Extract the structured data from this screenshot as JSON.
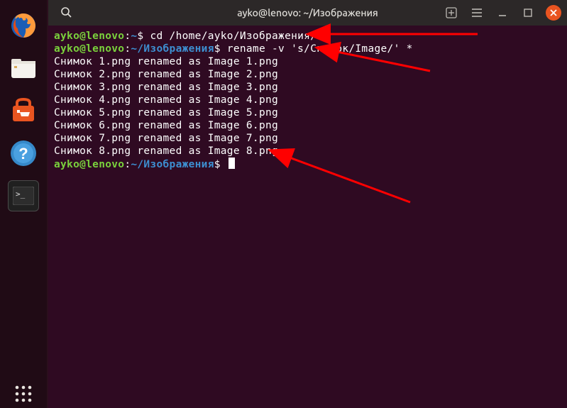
{
  "window": {
    "title": "ayko@lenovo: ~/Изображения"
  },
  "dock": {
    "items": [
      {
        "name": "firefox"
      },
      {
        "name": "files"
      },
      {
        "name": "software-store"
      },
      {
        "name": "help"
      },
      {
        "name": "terminal",
        "active": true
      }
    ],
    "apps": {
      "name": "show-applications"
    }
  },
  "terminal": {
    "prompt1": {
      "user": "ayko@lenovo",
      "sep": ":",
      "path": "~",
      "dollar": "$ ",
      "cmd": "cd /home/ayko/Изображения/"
    },
    "prompt2": {
      "user": "ayko@lenovo",
      "sep": ":",
      "path": "~/Изображения",
      "dollar": "$ ",
      "cmd": "rename -v 's/Снимок/Image/' *"
    },
    "output": [
      "Снимок 1.png renamed as Image 1.png",
      "Снимок 2.png renamed as Image 2.png",
      "Снимок 3.png renamed as Image 3.png",
      "Снимок 4.png renamed as Image 4.png",
      "Снимок 5.png renamed as Image 5.png",
      "Снимок 6.png renamed as Image 6.png",
      "Снимок 7.png renamed as Image 7.png",
      "Снимок 8.png renamed as Image 8.png"
    ],
    "prompt3": {
      "user": "ayko@lenovo",
      "sep": ":",
      "path": "~/Изображения",
      "dollar": "$ "
    }
  }
}
